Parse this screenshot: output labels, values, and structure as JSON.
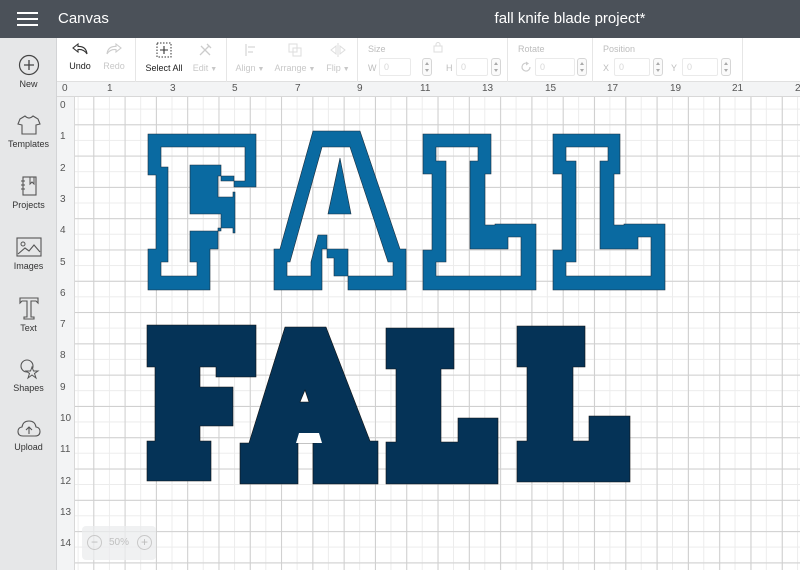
{
  "header": {
    "app_title": "Canvas",
    "document_title": "fall knife blade project*"
  },
  "sidebar": {
    "items": [
      {
        "label": "New",
        "icon": "plus-circle-icon"
      },
      {
        "label": "Templates",
        "icon": "tshirt-icon"
      },
      {
        "label": "Projects",
        "icon": "notebook-icon"
      },
      {
        "label": "Images",
        "icon": "image-icon"
      },
      {
        "label": "Text",
        "icon": "text-t-icon"
      },
      {
        "label": "Shapes",
        "icon": "shapes-icon"
      },
      {
        "label": "Upload",
        "icon": "cloud-upload-icon"
      }
    ]
  },
  "toolbar": {
    "undo": "Undo",
    "redo": "Redo",
    "select_all": "Select All",
    "edit": "Edit",
    "align": "Align",
    "arrange": "Arrange",
    "flip": "Flip",
    "size_label": "Size",
    "w_label": "W",
    "w_value": "0",
    "h_label": "H",
    "h_value": "0",
    "rotate_label": "Rotate",
    "rotate_value": "0",
    "position_label": "Position",
    "x_label": "X",
    "x_value": "0",
    "y_label": "Y",
    "y_value": "0"
  },
  "ruler": {
    "top": [
      "0",
      "1",
      "3",
      "5",
      "7",
      "9",
      "11",
      "13",
      "15",
      "17",
      "19",
      "21",
      "2"
    ],
    "left": [
      "0",
      "1",
      "2",
      "3",
      "4",
      "5",
      "6",
      "7",
      "8",
      "9",
      "10",
      "11",
      "12",
      "13",
      "14"
    ]
  },
  "canvas": {
    "outline_text": "FALL",
    "solid_text": "FALL",
    "colors": {
      "outline_fill": "#0a6aa1",
      "solid_fill": "#053357",
      "topbar": "#4b5159"
    }
  },
  "zoom": {
    "value": "50%",
    "minus": "−",
    "plus": "+"
  }
}
